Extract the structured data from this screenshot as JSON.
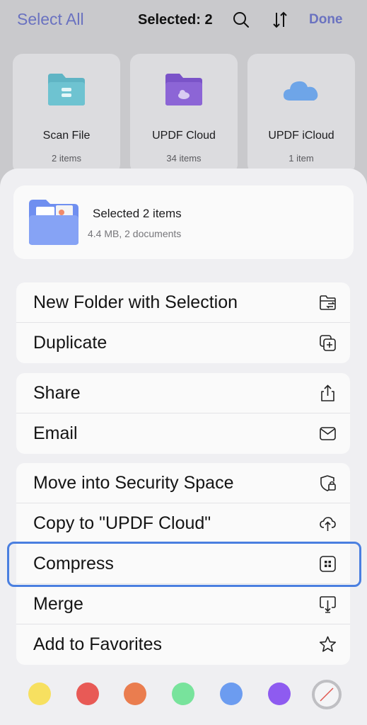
{
  "topbar": {
    "select_all": "Select All",
    "selected": "Selected: 2",
    "done": "Done"
  },
  "cards": [
    {
      "name": "Scan File",
      "count": "2 items",
      "icon": "teal-folder-icon"
    },
    {
      "name": "UPDF Cloud",
      "count": "34 items",
      "icon": "purple-cloud-folder-icon"
    },
    {
      "name": "UPDF iCloud",
      "count": "1 item",
      "icon": "icloud-icon"
    }
  ],
  "summary": {
    "title": "Selected 2 items",
    "subtitle": "4.4 MB, 2 documents"
  },
  "groups": {
    "g1": [
      {
        "label": "New Folder with Selection",
        "icon": "folder-move-icon"
      },
      {
        "label": "Duplicate",
        "icon": "duplicate-icon"
      }
    ],
    "g2": [
      {
        "label": "Share",
        "icon": "share-icon"
      },
      {
        "label": "Email",
        "icon": "envelope-icon"
      }
    ],
    "g3": [
      {
        "label": "Move into Security Space",
        "icon": "shield-lock-icon"
      },
      {
        "label": "Copy to \"UPDF Cloud\"",
        "icon": "cloud-upload-icon"
      },
      {
        "label": "Compress",
        "icon": "compress-icon"
      },
      {
        "label": "Merge",
        "icon": "merge-icon"
      },
      {
        "label": "Add to Favorites",
        "icon": "star-icon"
      }
    ]
  },
  "colors": [
    "#f7e060",
    "#e85a56",
    "#ea7d4f",
    "#78e39c",
    "#6c9cf0",
    "#8e5bf0"
  ],
  "accent": "#6a72c0",
  "highlight_color": "#4a7fe0"
}
